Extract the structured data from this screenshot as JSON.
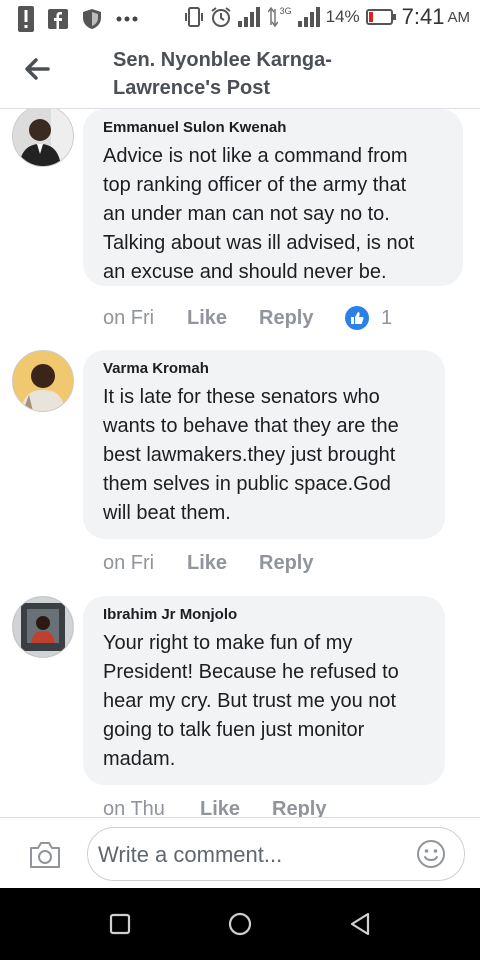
{
  "status_bar": {
    "battery_percent": "14%",
    "time": "7:41",
    "ampm": "AM",
    "network": "3G",
    "icons": [
      "alert-icon",
      "facebook-icon",
      "shield-icon",
      "more-dots-icon",
      "vibrate-icon",
      "alarm-icon",
      "signal-icon",
      "signal-3g-icon",
      "battery-icon"
    ]
  },
  "header": {
    "back_icon": "arrow-left-icon",
    "title_line1": "Sen. Nyonblee Karnga-",
    "title_line2": "Lawrence's Post"
  },
  "comments": [
    {
      "author": "Emmanuel Sulon Kwenah",
      "lines": [
        "Advice is not like a command from",
        "top ranking officer of the army that",
        "an under man can not say no to.",
        "Talking about was ill advised, is not",
        "an excuse and should never be."
      ],
      "time": "on Fri",
      "like": "Like",
      "reply": "Reply",
      "reaction_count": "1"
    },
    {
      "author": "Varma Kromah",
      "lines": [
        "It is late for these senators who",
        "wants to behave that they are the",
        "best lawmakers.they just brought",
        "them selves in public space.God",
        "will beat them."
      ],
      "time": "on Fri",
      "like": "Like",
      "reply": "Reply"
    },
    {
      "author": "Ibrahim Jr Monjolo",
      "lines": [
        "Your right to make fun of my",
        "President! Because he refused to",
        "hear my cry. But trust me you not",
        "going to talk fuen just monitor",
        "madam."
      ],
      "time": "on Thu",
      "like": "Like",
      "reply": "Reply"
    }
  ],
  "composer": {
    "camera_icon": "camera-icon",
    "placeholder": "Write a comment...",
    "emoji_icon": "smiley-icon"
  },
  "nav": {
    "icons": [
      "recents-square-icon",
      "home-circle-icon",
      "back-triangle-icon"
    ]
  },
  "colors": {
    "bubble": "#f2f3f5",
    "meta_text": "#90949c",
    "like_blue": "#2d7fe8",
    "title_gray": "#4b4f56"
  }
}
